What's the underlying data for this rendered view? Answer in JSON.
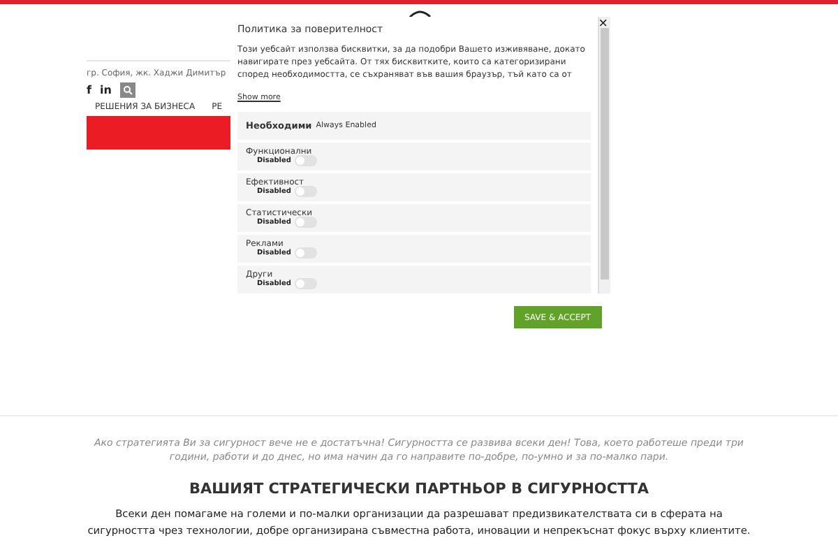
{
  "header": {
    "address": "гр. София, жк. Хаджи Димитър",
    "social": [
      "f",
      "in"
    ],
    "nav": [
      "РЕШЕНИЯ ЗА БИЗНЕСА",
      "РЕ"
    ]
  },
  "intro": {
    "quote": "Ако стратегията Ви за сигурност вече не е достатъчна! Сигурността се развива всеки ден! Това, което работеше преди три години, работи и до днес, но има начин да го направите по-добре, по-умно и за по-малко пари.",
    "heading": "ВАШИЯТ СТРАТЕГИЧЕСКИ ПАРТНЬОР В СИГУРНОСТТА",
    "body": "Всеки ден помагаме на големи и по-малки организации да разрешават предизвикателствата си в сферата на сигурността чрез технологии, добре организирана съвместна работа, иновации и непрекъснат фокус върху клиентите."
  },
  "cookie_dialog": {
    "close": "×",
    "title": "Политика за поверителност",
    "description": "Този уебсайт използва бисквитки, за да подобри Вашето изживяване, докато навигирате през уебсайта. От тях бисквитките, които са категоризирани според необходимостта, се съхраняват във вашия браузър, тъй като са от",
    "show_more": "Show more",
    "categories": [
      {
        "kind": "always",
        "name": "Необходими",
        "status": "Always Enabled"
      },
      {
        "kind": "toggle",
        "name": "Функционални",
        "status": "Disabled",
        "on": false
      },
      {
        "kind": "toggle",
        "name": "Ефективност",
        "status": "Disabled",
        "on": false
      },
      {
        "kind": "toggle",
        "name": "Статистически",
        "status": "Disabled",
        "on": false
      },
      {
        "kind": "toggle",
        "name": "Реклами",
        "status": "Disabled",
        "on": false
      },
      {
        "kind": "toggle",
        "name": "Други",
        "status": "Disabled",
        "on": false
      }
    ],
    "button": "SAVE & ACCEPT"
  }
}
